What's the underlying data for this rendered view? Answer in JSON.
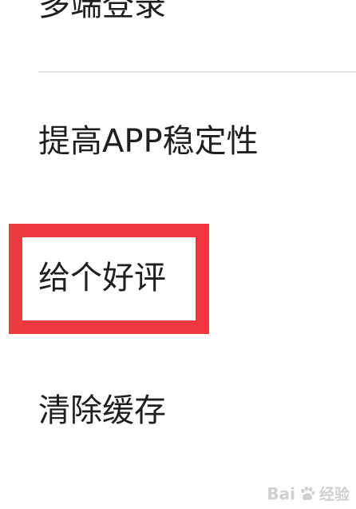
{
  "menu": {
    "items": [
      {
        "label": "多端登录"
      },
      {
        "label": "提高APP稳定性"
      },
      {
        "label": "给个好评"
      },
      {
        "label": "清除缓存"
      }
    ]
  },
  "highlight": {
    "color": "#ee3a3e",
    "target": "给个好评"
  },
  "watermark": {
    "brand": "Bai",
    "brand_suffix": "经验",
    "icon": "baidu-paw-icon"
  }
}
